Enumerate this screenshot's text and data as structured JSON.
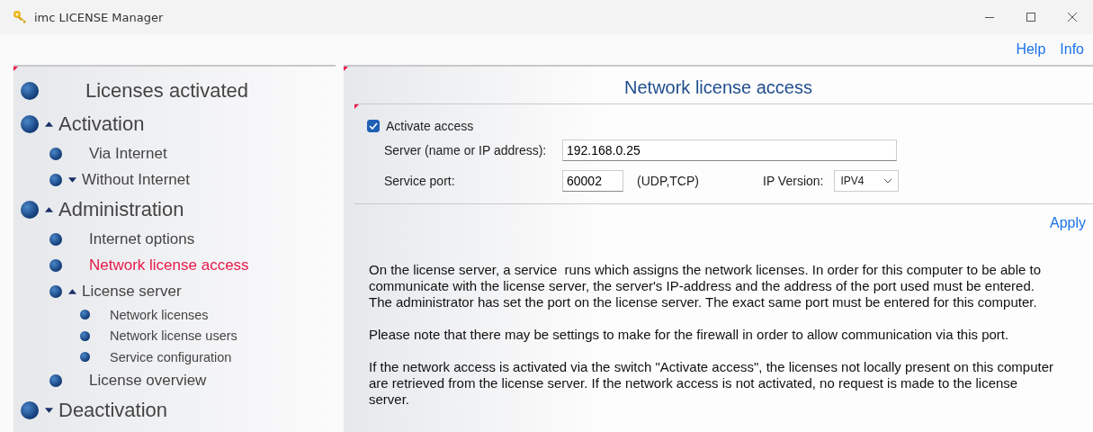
{
  "window": {
    "title": "imc LICENSE Manager"
  },
  "top_links": [
    "Help",
    "Info"
  ],
  "tree": [
    {
      "label": "Licenses activated",
      "selected": false
    },
    {
      "label": "Activation",
      "selected": false,
      "expanded": true,
      "children": [
        {
          "label": "Via Internet",
          "selected": false
        },
        {
          "label": "Without Internet",
          "selected": false,
          "expanded": false
        }
      ]
    },
    {
      "label": "Administration",
      "selected": false,
      "expanded": true,
      "children": [
        {
          "label": "Internet options",
          "selected": false
        },
        {
          "label": "Network license access",
          "selected": true
        },
        {
          "label": "License server",
          "selected": false,
          "expanded": true,
          "children": [
            {
              "label": "Network licenses",
              "selected": false
            },
            {
              "label": "Network license users",
              "selected": false
            },
            {
              "label": "Service configuration",
              "selected": false
            }
          ]
        },
        {
          "label": "License overview",
          "selected": false
        }
      ]
    },
    {
      "label": "Deactivation",
      "selected": false,
      "expanded": false
    }
  ],
  "content": {
    "title": "Network license access",
    "activate": {
      "label": "Activate access",
      "checked": true
    },
    "server": {
      "label": "Server (name or IP address):",
      "value": "192.168.0.25"
    },
    "port": {
      "label": "Service port:",
      "value": "60002",
      "protocol": "(UDP,TCP)"
    },
    "ip_version": {
      "label": "IP Version:",
      "value": "IPV4"
    },
    "apply": "Apply",
    "paragraphs": [
      "On the license server, a service  runs which assigns the network licenses. In order for this computer to be able to communicate with the license server, the server's IP-address and the address of the port used must be entered. The administrator has set the port on the license server. The exact same port must be entered for this computer.",
      "Please note that there may be settings to make for the firewall in order to allow communication via this port.",
      "If the network access is activated via the switch \"Activate access\", the licenses not locally present on this computer are retrieved from the license server. If the network access is not activated, no request is made to the license server."
    ]
  }
}
